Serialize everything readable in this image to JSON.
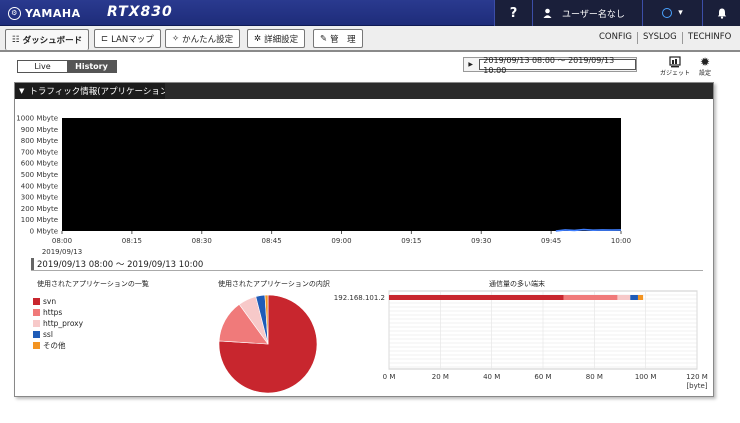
{
  "header": {
    "brand": "YAMAHA",
    "model": "RTX830",
    "help_label": "?",
    "user_label": "ユーザー名なし",
    "bell_icon": "bell-icon"
  },
  "nav": {
    "tabs": [
      {
        "label": "ダッシュボード",
        "icon": "grid-icon"
      },
      {
        "label": "LANマップ",
        "icon": "network-map-icon"
      },
      {
        "label": "かんたん設定",
        "icon": "wand-icon"
      },
      {
        "label": "詳細設定",
        "icon": "gear-icon"
      },
      {
        "label": "管　理",
        "icon": "wrench-icon"
      }
    ],
    "links": [
      "CONFIG",
      "SYSLOG",
      "TECHINFO"
    ]
  },
  "mode": {
    "live": "Live",
    "history": "History"
  },
  "range_control": {
    "value": "2019/09/13 08:00 ～ 2019/09/13 10:00"
  },
  "tools": {
    "gadget": "ガジェット",
    "settings": "設定"
  },
  "panel": {
    "title": "トラフィック情報(アプリケーション)",
    "range_text": "2019/09/13 08:00 ～ 2019/09/13 10:00",
    "apps_title": "使用されたアプリケーションの一覧",
    "breakdown_title": "使用されたアプリケーションの内訳",
    "top_title": "通信量の多い端末"
  },
  "colors": {
    "svn": "#c8262e",
    "https": "#f07a7a",
    "http_proxy": "#f7c9c9",
    "ssl": "#1f5cb8",
    "other": "#f39422"
  },
  "chart_data": [
    {
      "type": "line",
      "title": "",
      "x": [
        "08:00",
        "08:15",
        "08:30",
        "08:45",
        "09:00",
        "09:15",
        "09:30",
        "09:45",
        "10:00"
      ],
      "x_date": "2019/09/13",
      "y_ticks": [
        "0 Mbyte",
        "100 Mbyte",
        "200 Mbyte",
        "300 Mbyte",
        "400 Mbyte",
        "500 Mbyte",
        "600 Mbyte",
        "700 Mbyte",
        "800 Mbyte",
        "900 Mbyte",
        "1000 Mbyte"
      ],
      "ylim": [
        0,
        1000
      ],
      "series": [
        {
          "points": [
            [
              "09:46",
              0
            ],
            [
              "09:48",
              10
            ],
            [
              "09:50",
              5
            ],
            [
              "09:52",
              12
            ],
            [
              "09:54",
              7
            ],
            [
              "09:56",
              10
            ],
            [
              "09:58",
              8
            ],
            [
              "10:00",
              10
            ]
          ]
        }
      ]
    },
    {
      "type": "pie",
      "title": "使用されたアプリケーションの内訳",
      "labels": [
        "svn",
        "https",
        "http_proxy",
        "ssl",
        "その他"
      ],
      "values": [
        76,
        14,
        6,
        3,
        1
      ]
    },
    {
      "type": "bar",
      "title": "通信量の多い端末",
      "categories": [
        "192.168.101.2"
      ],
      "x_ticks": [
        "0 M",
        "20 M",
        "40 M",
        "60 M",
        "80 M",
        "100 M",
        "120 M"
      ],
      "x_unit": "[byte]",
      "xlim": [
        0,
        120
      ],
      "series": [
        {
          "name": "svn",
          "values": [
            68
          ]
        },
        {
          "name": "https",
          "values": [
            21
          ]
        },
        {
          "name": "http_proxy",
          "values": [
            5
          ]
        },
        {
          "name": "ssl",
          "values": [
            3
          ]
        },
        {
          "name": "その他",
          "values": [
            2
          ]
        }
      ]
    }
  ]
}
